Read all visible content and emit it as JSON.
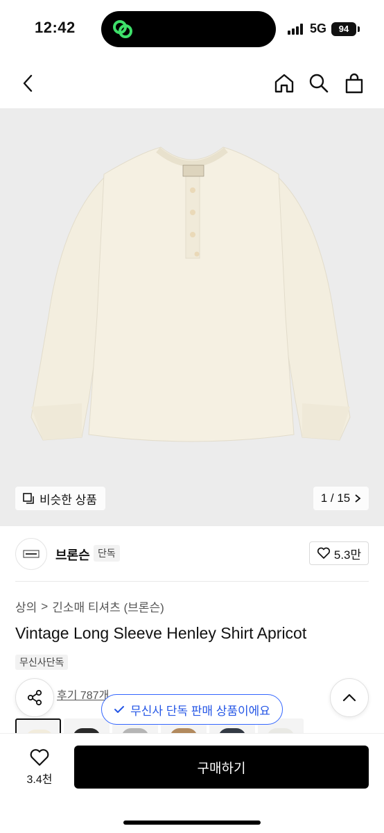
{
  "status_bar": {
    "time": "12:42",
    "network": "5G",
    "battery": "94"
  },
  "nav": {
    "back_icon": "chevron-left-icon",
    "home_icon": "home-icon",
    "search_icon": "search-icon",
    "cart_icon": "shopping-bag-icon"
  },
  "gallery": {
    "similar_label": "비슷한 상품",
    "pager": "1 / 15"
  },
  "brand": {
    "name": "브론슨",
    "tag": "단독",
    "likes": "5.3만"
  },
  "breadcrumb": {
    "category": "상의",
    "separator": ">",
    "subcategory": "긴소매 티셔츠 (브론슨)"
  },
  "product": {
    "title": "Vintage Long Sleeve Henley Shirt Apricot",
    "exclusive_tag": "무신사단독",
    "review_link": "후기 787개"
  },
  "toast": {
    "text": "무신사 단독 판매 상품이에요"
  },
  "colors": {
    "accent_blue": "#2456e6",
    "shirt_apricot": "#f2ecdc",
    "buy_button": "#000000"
  },
  "bottom_bar": {
    "wish_count": "3.4천",
    "buy_label": "구매하기"
  }
}
